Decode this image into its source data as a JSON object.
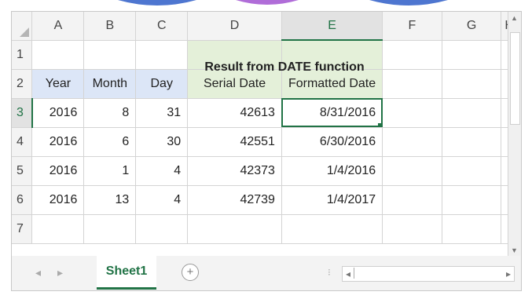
{
  "columns": [
    "A",
    "B",
    "C",
    "D",
    "E",
    "F",
    "G",
    "H"
  ],
  "rows": [
    "1",
    "2",
    "3",
    "4",
    "5",
    "6",
    "7"
  ],
  "selected_column": "E",
  "selected_row": "3",
  "title": "Result from DATE function",
  "headers": {
    "year": "Year",
    "month": "Month",
    "day": "Day",
    "serial": "Serial Date",
    "formatted": "Formatted Date"
  },
  "data_rows": [
    {
      "year": "2016",
      "month": "8",
      "day": "31",
      "serial": "42613",
      "formatted": "8/31/2016"
    },
    {
      "year": "2016",
      "month": "6",
      "day": "30",
      "serial": "42551",
      "formatted": "6/30/2016"
    },
    {
      "year": "2016",
      "month": "1",
      "day": "4",
      "serial": "42373",
      "formatted": "1/4/2016"
    },
    {
      "year": "2016",
      "month": "13",
      "day": "4",
      "serial": "42739",
      "formatted": "1/4/2017"
    }
  ],
  "tabs": {
    "sheet_name": "Sheet1",
    "add_label": "+",
    "nav_prev": "◂",
    "nav_next": "▸"
  },
  "colors": {
    "accent": "#217346",
    "input_fill": "#dce6f7",
    "result_fill": "#e4f0d9"
  },
  "icons": {
    "add_sheet": "plus-circle-icon",
    "scroll_up": "triangle-up-icon",
    "scroll_down": "triangle-down-icon"
  }
}
